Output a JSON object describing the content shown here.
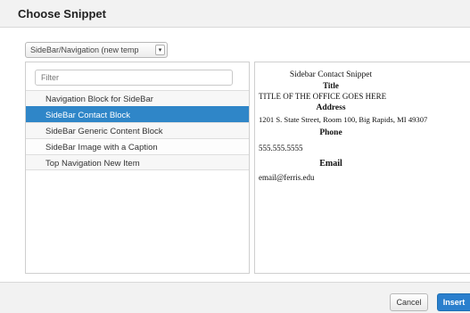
{
  "dialog": {
    "title": "Choose Snippet"
  },
  "category_select": {
    "value": "SideBar/Navigation (new temp",
    "arrow": "▾"
  },
  "filter": {
    "placeholder": "Filter",
    "value": ""
  },
  "snippets": [
    {
      "label": "Navigation Block for SideBar",
      "selected": false
    },
    {
      "label": "SideBar Contact Block",
      "selected": true
    },
    {
      "label": "SideBar Generic Content Block",
      "selected": false
    },
    {
      "label": "SideBar Image with a Caption",
      "selected": false
    },
    {
      "label": "Top Navigation New Item",
      "selected": false
    }
  ],
  "preview": {
    "heading": "Sidebar Contact Snippet",
    "title_label": "Title",
    "title_value": "TITLE OF THE OFFICE GOES HERE",
    "address_label": "Address",
    "address_value": "1201 S. State Street, Room 100, Big Rapids, MI 49307",
    "phone_label": "Phone",
    "phone_value": "555.555.5555",
    "email_label": "Email",
    "email_value": "email@ferris.edu"
  },
  "footer": {
    "cancel_label": "Cancel",
    "insert_label": "Insert"
  },
  "colors": {
    "selection": "#2f86c8",
    "primary_button": "#2a7fcd",
    "header_bg": "#f2f2f2"
  }
}
